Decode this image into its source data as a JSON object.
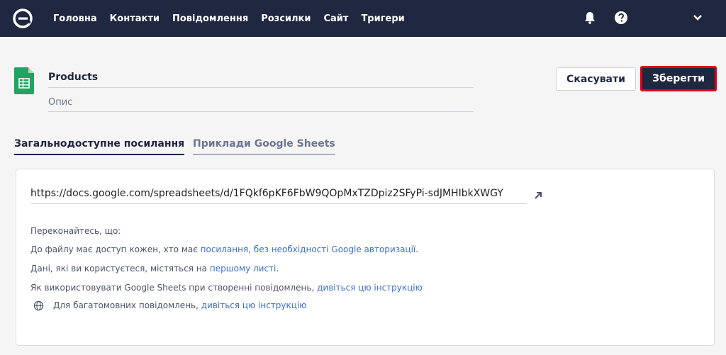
{
  "nav": {
    "items": [
      "Головна",
      "Контакти",
      "Повідомлення",
      "Розсилки",
      "Сайт",
      "Тригери"
    ]
  },
  "icons": {
    "logo": "esputnik-logo",
    "bell": "bell-icon",
    "help": "question-circle-icon",
    "chevron": "chevron-down-icon",
    "sheet": "google-sheets-icon",
    "external": "external-link-icon",
    "globe": "globe-icon"
  },
  "colors": {
    "topbar": "#1f2741",
    "accent": "#3a6fc9",
    "save_border": "#e0001b",
    "sheets_green": "#1fa463"
  },
  "header": {
    "title": "Products",
    "description_placeholder": "Опис"
  },
  "actions": {
    "cancel": "Скасувати",
    "save": "Зберегти"
  },
  "tabs": [
    {
      "label": "Загальнодоступне посилання",
      "active": true
    },
    {
      "label": "Приклади Google Sheets",
      "active": false
    }
  ],
  "card": {
    "url": "https://docs.google.com/spreadsheets/d/1FQkf6pKF6FbW9QOpMxTZDpiz2SFyPi-sdJMHIbkXWGY",
    "intro": "Переконайтесь, що:",
    "line1_text": "До файлу має доступ кожен, хто має ",
    "line1_link": "посилання, без необхідності Google авторизації",
    "line1_end": ".",
    "line2_text": "Дані, які ви користуєтеся, містяться на ",
    "line2_link": "першому листі",
    "line2_end": ".",
    "line3_text": "Як використовувати Google Sheets при створенні повідомлень, ",
    "line3_link": "дивіться цю інструкцію",
    "line4_text": "Для багатомовних повідомлень, ",
    "line4_link": "дивіться цю інструкцію"
  }
}
